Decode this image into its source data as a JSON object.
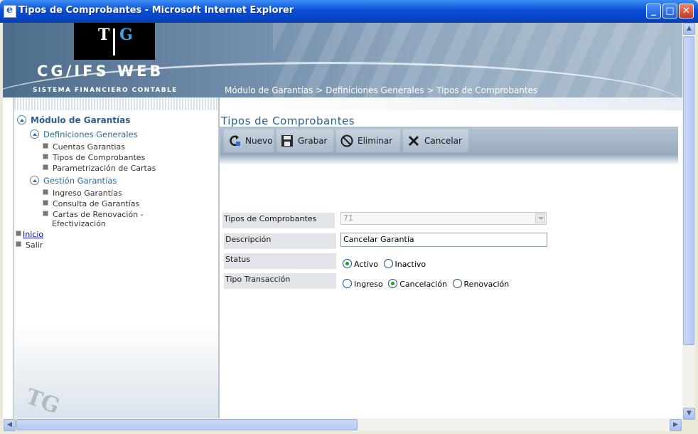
{
  "window": {
    "title": "Tipos de Comprobantes - Microsoft Internet Explorer"
  },
  "header": {
    "logo_left": "T",
    "logo_right": "G",
    "brand": "CG/IFS WEB",
    "brand_subtitle": "SISTEMA FINANCIERO CONTABLE",
    "breadcrumb": "Módulo de Garantías > Definiciones Generales > Tipos de Comprobantes"
  },
  "sidebar": {
    "module": "Módulo de Garantías",
    "group1": "Definiciones Generales",
    "group1_items": [
      "Cuentas Garantias",
      "Tipos de Comprobantes",
      "Parametrización de Cartas"
    ],
    "group2": "Gestión Garantías",
    "group2_items": [
      "Ingreso Garantías",
      "Consulta de Garantías",
      "Cartas de Renovación -",
      "Efectivización"
    ],
    "inicio": "Inicio",
    "salir": "Salir"
  },
  "main": {
    "title": "Tipos de Comprobantes",
    "toolbar": {
      "nuevo": "Nuevo",
      "grabar": "Grabar",
      "eliminar": "Eliminar",
      "cancelar": "Cancelar"
    },
    "form": {
      "tipos_label": "Tipos de Comprobantes",
      "tipos_value": "71",
      "descripcion_label": "Descripción",
      "descripcion_value": "Cancelar Garantía",
      "status_label": "Status",
      "status_options": [
        "Activo",
        "Inactivo"
      ],
      "status_selected": "Activo",
      "tipo_trans_label": "Tipo Transacción",
      "tipo_trans_options": [
        "Ingreso",
        "Cancelación",
        "Renovación"
      ],
      "tipo_trans_selected": "Cancelación"
    }
  },
  "colors": {
    "title_blue": "#2c5f90",
    "toolbar": "#a9bacb",
    "label_bg": "#e1e4e8",
    "radio_dot": "#21a121"
  }
}
